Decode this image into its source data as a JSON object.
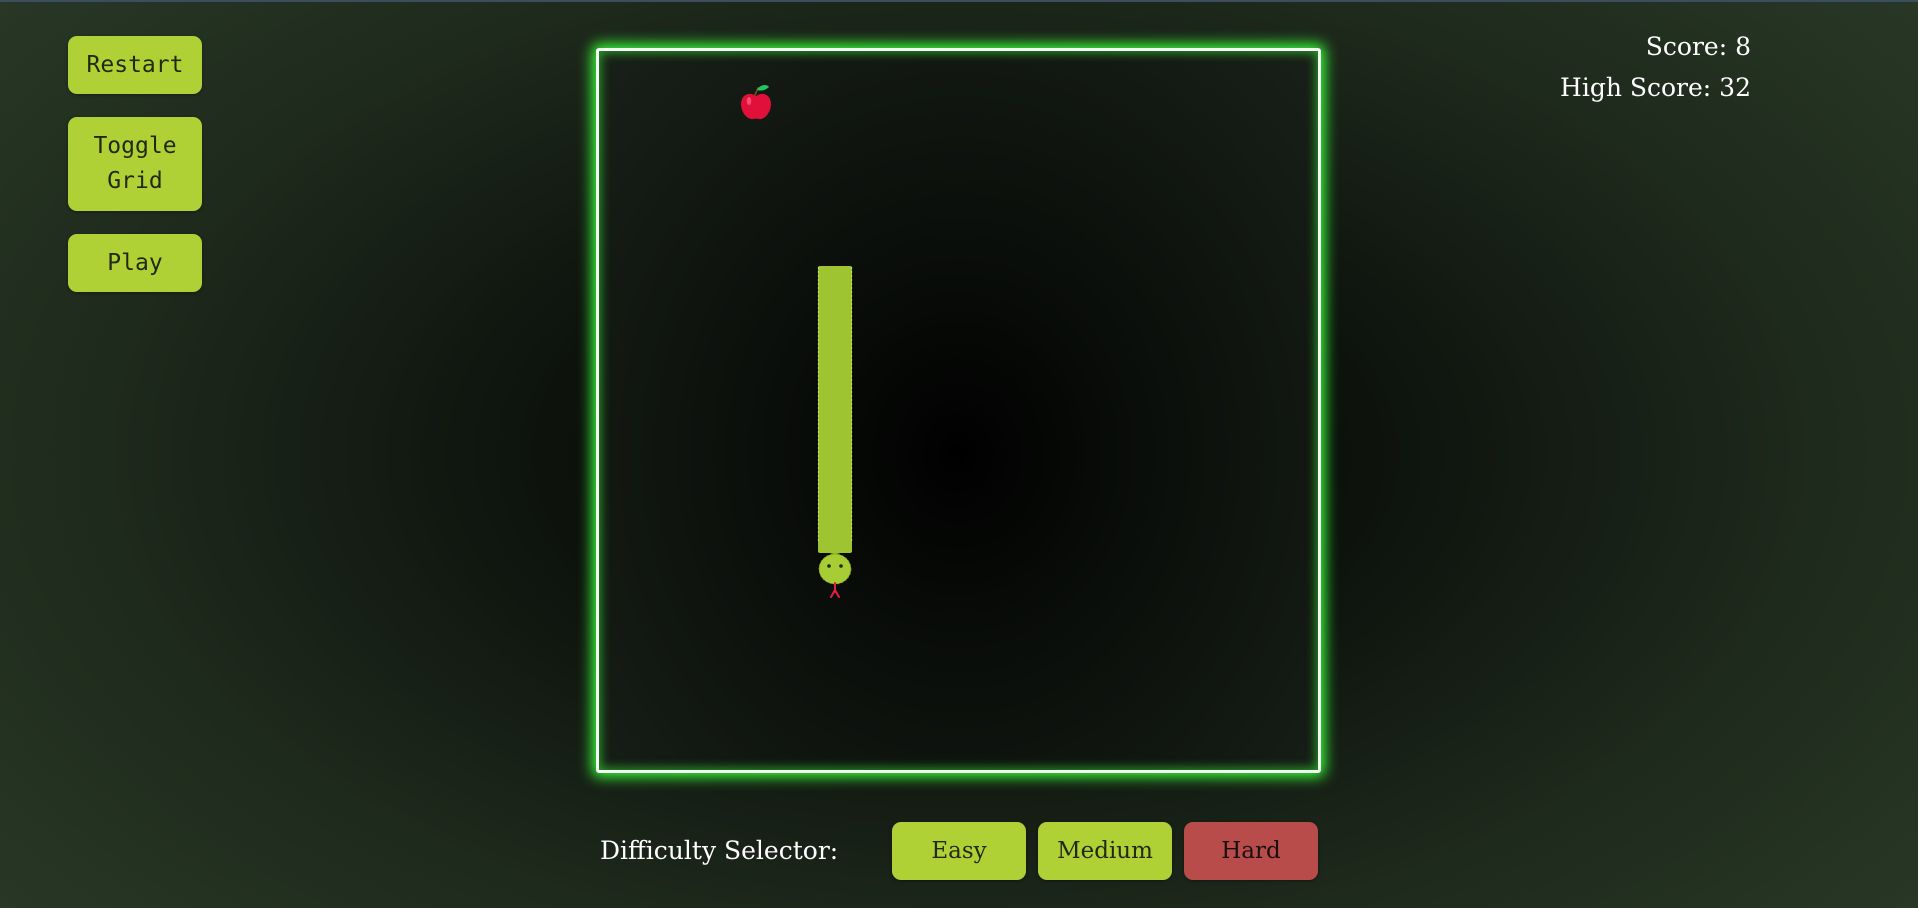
{
  "controls": {
    "restart_label": "Restart",
    "toggle_grid_label": "Toggle Grid",
    "play_label": "Play"
  },
  "scoreboard": {
    "score_text": "Score: 8",
    "high_score_text": "High Score: 32"
  },
  "game": {
    "food": "apple",
    "snake_direction": "down",
    "colors": {
      "board_border": "#f4fff4",
      "board_glow": "#3aff3a",
      "snake_body": "#9fc431",
      "snake_head": "#a8cc34",
      "snake_tongue": "#e11d48",
      "apple": "#e0103a",
      "apple_leaf": "#22c55e"
    }
  },
  "difficulty": {
    "label": "Difficulty Selector:",
    "options": [
      {
        "label": "Easy",
        "selected": false
      },
      {
        "label": "Medium",
        "selected": false
      },
      {
        "label": "Hard",
        "selected": true
      }
    ],
    "colors": {
      "default_button": "#b0d136",
      "selected_button": "#b84c4b"
    }
  }
}
